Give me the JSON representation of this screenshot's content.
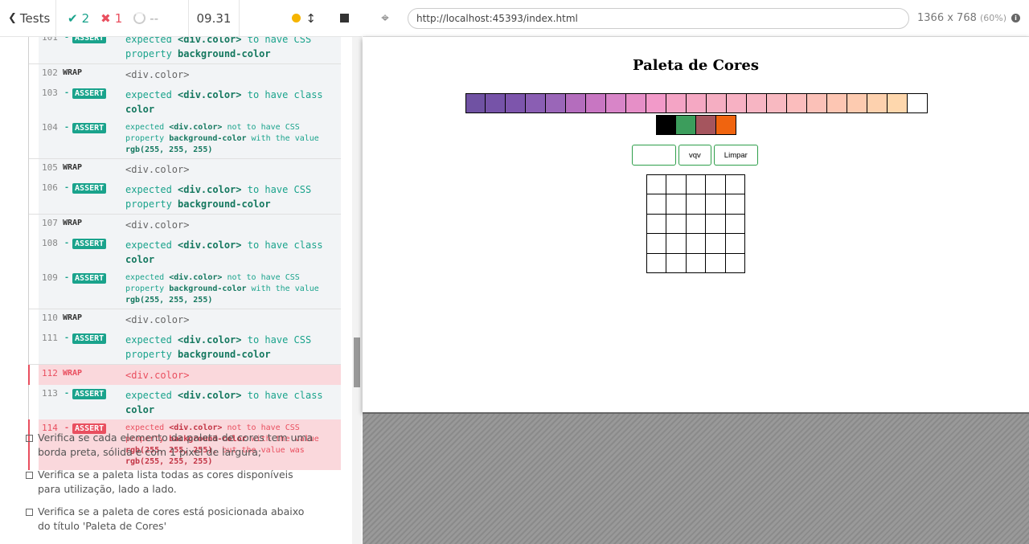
{
  "header": {
    "tests_label": "Tests",
    "passed": "2",
    "failed": "1",
    "pending": "--",
    "duration": "09.31"
  },
  "commands": [
    {
      "num": "101",
      "type": "assert",
      "msg": [
        "expected ",
        "<div.color>",
        " to have CSS property ",
        "background-color"
      ],
      "cut": true
    },
    {
      "num": "102",
      "type": "wrap",
      "msg": "<div.color>"
    },
    {
      "num": "103",
      "type": "assert",
      "msg": [
        "expected ",
        "<div.color>",
        " to have class ",
        "color"
      ]
    },
    {
      "num": "104",
      "type": "assert-small",
      "msg": [
        "expected ",
        "<div.color>",
        " not to have CSS property ",
        "background-color",
        " with the value ",
        "rgb(255, 255, 255)"
      ]
    },
    {
      "num": "105",
      "type": "wrap",
      "msg": "<div.color>"
    },
    {
      "num": "106",
      "type": "assert",
      "msg": [
        "expected ",
        "<div.color>",
        " to have CSS property ",
        "background-color"
      ]
    },
    {
      "num": "107",
      "type": "wrap",
      "msg": "<div.color>"
    },
    {
      "num": "108",
      "type": "assert",
      "msg": [
        "expected ",
        "<div.color>",
        " to have class ",
        "color"
      ]
    },
    {
      "num": "109",
      "type": "assert-small",
      "msg": [
        "expected ",
        "<div.color>",
        " not to have CSS property ",
        "background-color",
        " with the value ",
        "rgb(255, 255, 255)"
      ]
    },
    {
      "num": "110",
      "type": "wrap",
      "msg": "<div.color>"
    },
    {
      "num": "111",
      "type": "assert",
      "msg": [
        "expected ",
        "<div.color>",
        " to have CSS property ",
        "background-color"
      ]
    },
    {
      "num": "112",
      "type": "wrap",
      "msg": "<div.color>",
      "failed": true
    },
    {
      "num": "113",
      "type": "assert",
      "msg": [
        "expected ",
        "<div.color>",
        " to have class ",
        "color"
      ]
    },
    {
      "num": "114",
      "type": "assert-small",
      "failed": true,
      "msg": [
        "expected ",
        "<div.color>",
        " not to have CSS property ",
        "background-color",
        " with the value ",
        "rgb(255, 255, 255)",
        ", but the value was ",
        "rgb(255, 255, 255)"
      ]
    }
  ],
  "labels": {
    "wrap": "WRAP",
    "assert": "ASSERT",
    "dash": "-"
  },
  "tests": [
    "Verifica se cada elemento da paleta de cores tem uma borda preta, sólida e com 1 pixel de largura;",
    "Verifica se a paleta lista todas as cores disponíveis para utilização, lado a lado.",
    "Verifica se a paleta de cores está posicionada abaixo do título 'Paleta de Cores'"
  ],
  "aut": {
    "url": "http://localhost:45393/index.html",
    "viewport": "1366 x 768",
    "scale": "(60%)",
    "info_icon": "info-icon"
  },
  "app": {
    "title": "Paleta de Cores",
    "palette_row1": [
      "#7052a3",
      "#7653a8",
      "#7d55ac",
      "#8a5eb3",
      "#9a66b8",
      "#b46dbd",
      "#c876c2",
      "#d885c8",
      "#e68fc7",
      "#f29ac9",
      "#f4a4c5",
      "#f5a8c3",
      "#f5aec2",
      "#f7b1c3",
      "#f7b5c3",
      "#f8b9c1",
      "#fbbdbd",
      "#fbc1b8",
      "#fdc6b3",
      "#fdcbb0",
      "#fdd1ae",
      "#fed7ad",
      "#ffffff"
    ],
    "palette_row2": [
      "#000000",
      "#3c9d5c",
      "#a5555e",
      "#f0640f"
    ],
    "input_value": "",
    "vqv_label": "vqv",
    "clear_label": "Limpar",
    "board_size": 5
  },
  "colors": {
    "pass": "#1aa38c",
    "fail": "#e94f5f",
    "running_dot": "#f5b400",
    "button_border": "#2e9e4a"
  }
}
